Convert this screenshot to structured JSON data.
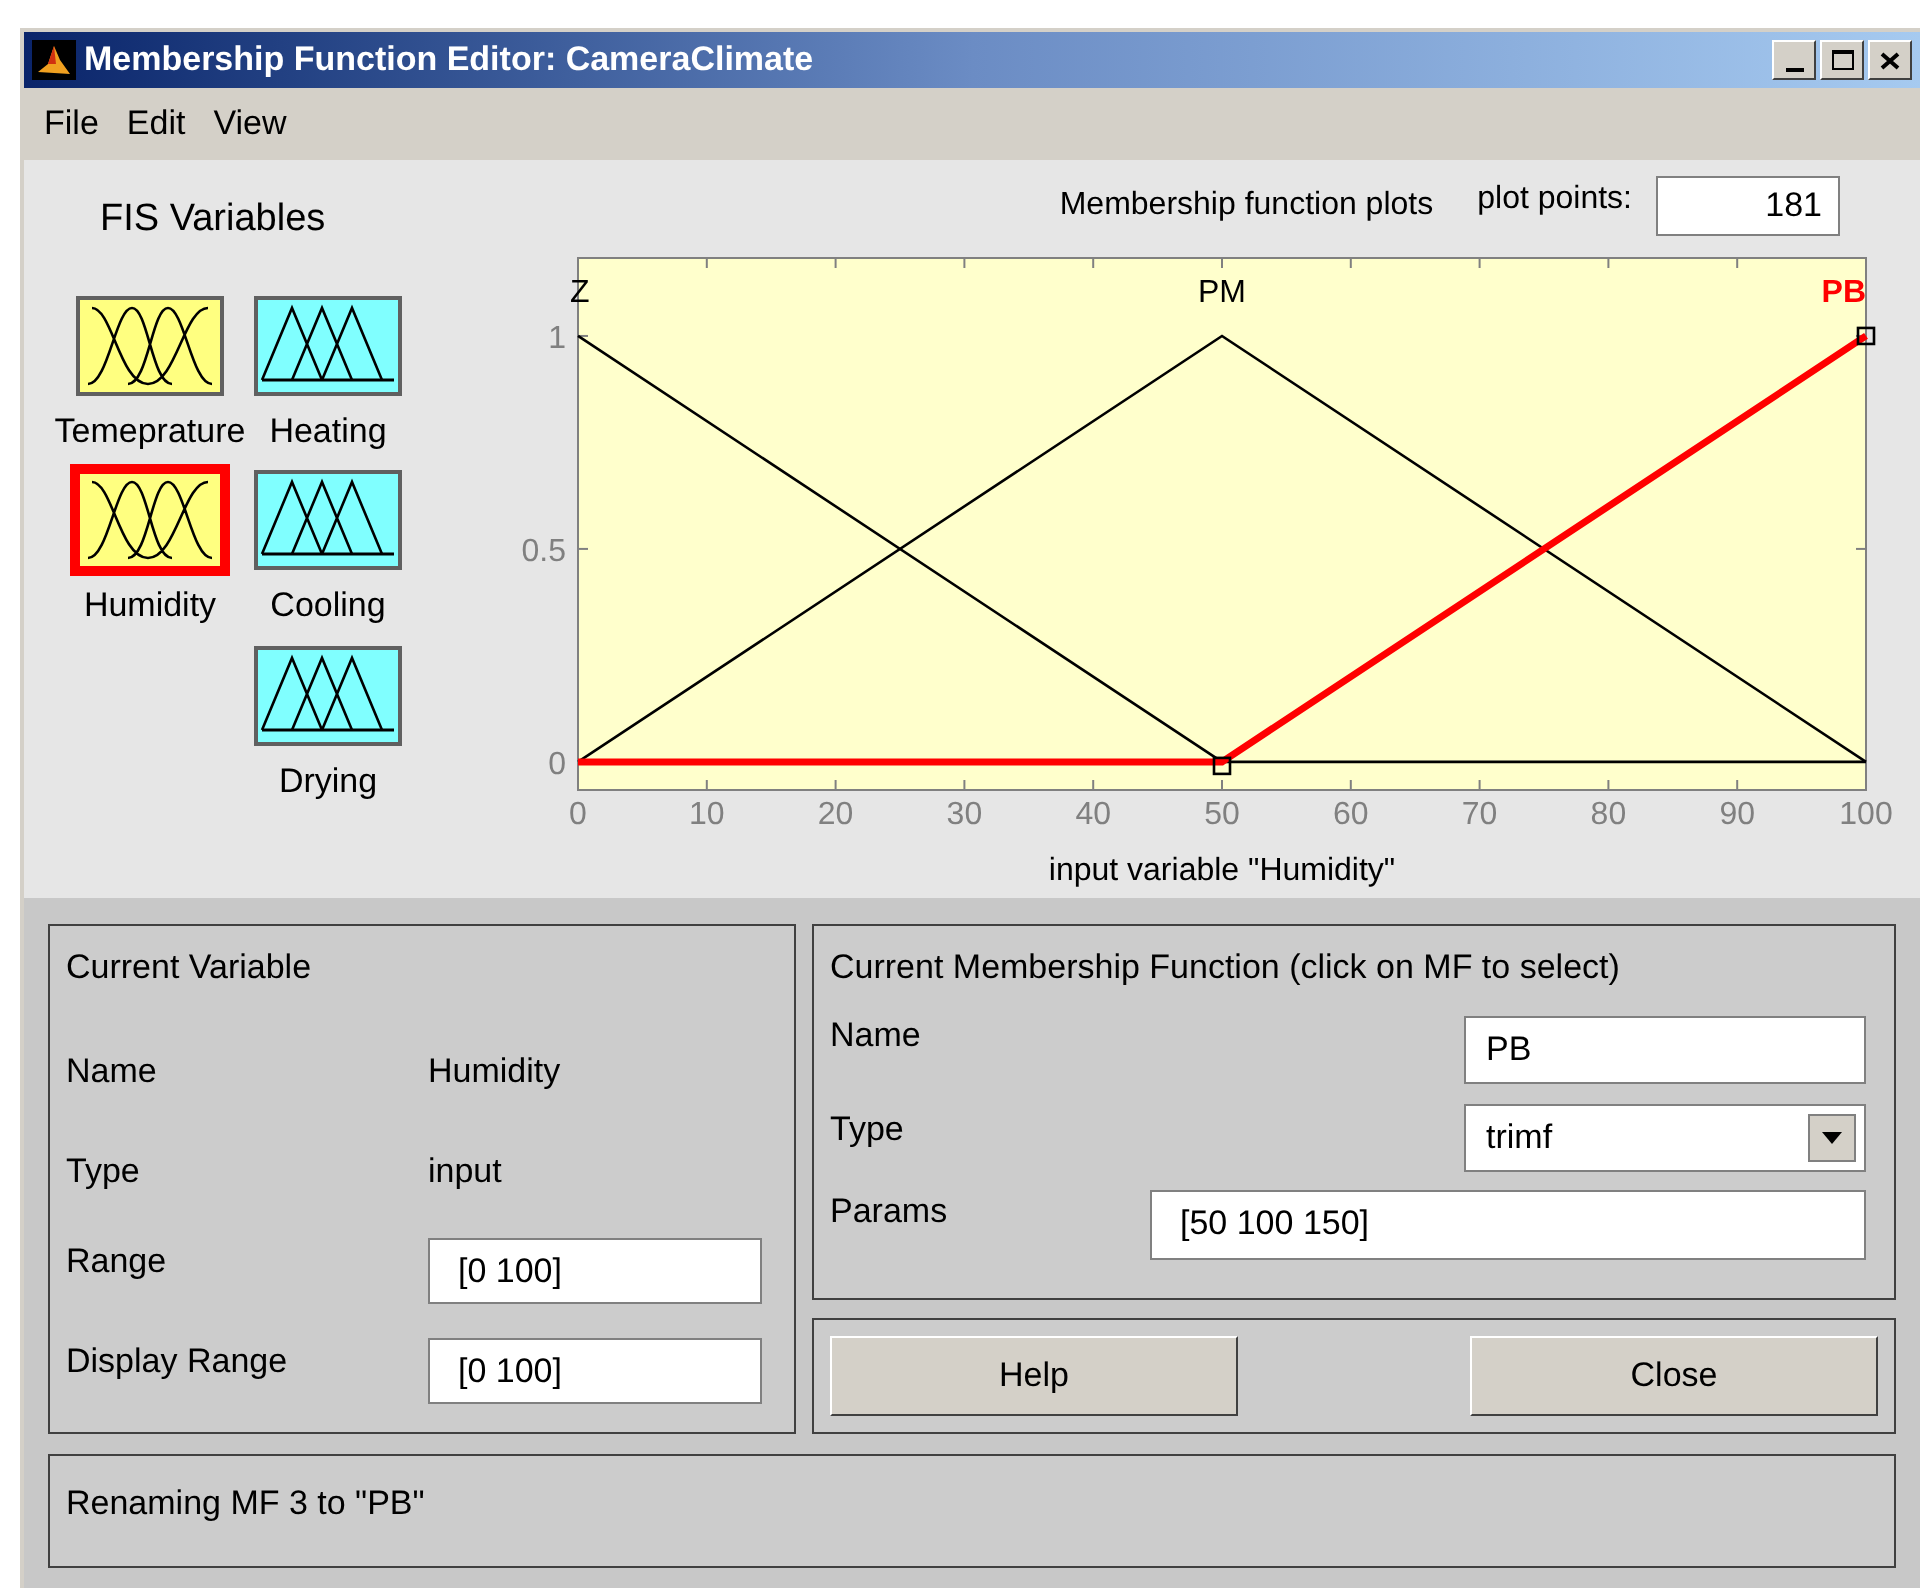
{
  "window": {
    "title": "Membership Function Editor: CameraClimate"
  },
  "menu": [
    "File",
    "Edit",
    "View"
  ],
  "fis_variables": {
    "title": "FIS Variables",
    "items": [
      {
        "name": "Temeprature",
        "kind": "input",
        "selected": false
      },
      {
        "name": "Heating",
        "kind": "output",
        "selected": false
      },
      {
        "name": "Humidity",
        "kind": "input",
        "selected": true
      },
      {
        "name": "Cooling",
        "kind": "output",
        "selected": false
      },
      {
        "name": "Drying",
        "kind": "output",
        "selected": false
      }
    ]
  },
  "plot": {
    "title": "Membership function plots",
    "plot_points_label": "plot points:",
    "plot_points": "181",
    "chart_data": {
      "type": "line",
      "xlabel": "input variable \"Humidity\"",
      "x": [
        0,
        50,
        100
      ],
      "series": [
        {
          "name": "Z",
          "color": "#000000",
          "values": [
            1,
            0,
            0
          ]
        },
        {
          "name": "PM",
          "color": "#000000",
          "values": [
            0,
            1,
            0
          ]
        },
        {
          "name": "PB",
          "color": "#ff0000",
          "values": [
            0,
            0,
            1
          ]
        }
      ],
      "xlim": [
        0,
        100
      ],
      "ylim": [
        -0.066,
        1.183
      ],
      "xticks": [
        0,
        10,
        20,
        30,
        40,
        50,
        60,
        70,
        80,
        90,
        100
      ],
      "yticks": [
        0,
        0.5,
        1
      ]
    }
  },
  "current_variable": {
    "title": "Current Variable",
    "fields": [
      {
        "label": "Name",
        "kind": "text",
        "value": "Humidity"
      },
      {
        "label": "Type",
        "kind": "text",
        "value": "input"
      },
      {
        "label": "Range",
        "kind": "input",
        "value": "[0 100]"
      },
      {
        "label": "Display Range",
        "kind": "input",
        "value": "[0 100]"
      }
    ]
  },
  "current_mf": {
    "title": "Current Membership Function (click on MF to select)",
    "name_label": "Name",
    "name": "PB",
    "type_label": "Type",
    "type": "trimf",
    "params_label": "Params",
    "params": "[50 100 150]"
  },
  "buttons": [
    "Help",
    "Close"
  ],
  "status": "Renaming MF 3 to \"PB\""
}
